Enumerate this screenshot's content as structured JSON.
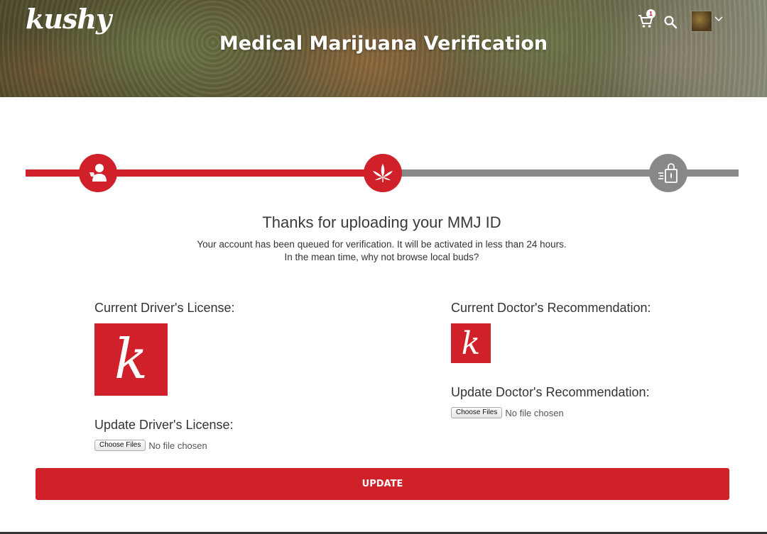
{
  "header": {
    "logo_text": "kushy",
    "title": "Medical Marijuana Verification",
    "cart_count": "1",
    "icons": [
      "cart-icon",
      "search-icon",
      "avatar",
      "chevron-down-icon"
    ]
  },
  "progress": {
    "steps": [
      {
        "icon": "user-id-icon",
        "state": "complete"
      },
      {
        "icon": "cannabis-leaf-icon",
        "state": "current"
      },
      {
        "icon": "shopping-bag-icon",
        "state": "pending"
      }
    ]
  },
  "message": {
    "title": "Thanks for uploading your MMJ ID",
    "line1": "Your account has been queued for verification. It will be activated in less than 24 hours.",
    "line2": "In the mean time, why not browse local buds?"
  },
  "drivers_license": {
    "current_label": "Current Driver's License:",
    "image_letter": "k",
    "update_label": "Update Driver's License:",
    "choose_label": "Choose Files",
    "file_status": "No file chosen"
  },
  "doctor_recommendation": {
    "current_label": "Current Doctor's Recommendation:",
    "image_letter": "k",
    "update_label": "Update Doctor's Recommendation:",
    "choose_label": "Choose Files",
    "file_status": "No file chosen"
  },
  "update_button": "UPDATE",
  "colors": {
    "brand_red": "#d0202a",
    "inactive_grey": "#888888"
  }
}
